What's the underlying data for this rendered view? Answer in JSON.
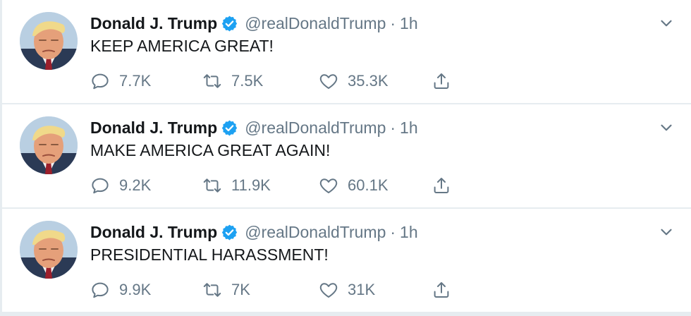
{
  "tweets": [
    {
      "name": "Donald J. Trump",
      "handle": "@realDonaldTrump",
      "separator": "·",
      "time": "1h",
      "text": "KEEP AMERICA GREAT!",
      "replies": "7.7K",
      "retweets": "7.5K",
      "likes": "35.3K"
    },
    {
      "name": "Donald J. Trump",
      "handle": "@realDonaldTrump",
      "separator": "·",
      "time": "1h",
      "text": "MAKE AMERICA GREAT AGAIN!",
      "replies": "9.2K",
      "retweets": "11.9K",
      "likes": "60.1K"
    },
    {
      "name": "Donald J. Trump",
      "handle": "@realDonaldTrump",
      "separator": "·",
      "time": "1h",
      "text": "PRESIDENTIAL HARASSMENT!",
      "replies": "9.9K",
      "retweets": "7K",
      "likes": "31K"
    }
  ],
  "icons": {
    "verified": "verified-badge-icon",
    "caret": "chevron-down-icon",
    "reply": "reply-icon",
    "retweet": "retweet-icon",
    "like": "heart-icon",
    "share": "share-icon"
  },
  "colors": {
    "verified": "#1da1f2",
    "secondary_text": "#657786",
    "primary_text": "#14171a",
    "divider": "#e6ecf0"
  }
}
